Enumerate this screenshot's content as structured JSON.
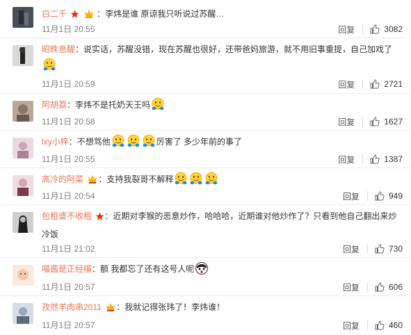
{
  "reply_label": "回复",
  "comments": [
    {
      "user": "白二千",
      "sep": "：",
      "text": "李炜是谁 原谅我只听说过苏醒…",
      "time": "11月1日 20:55",
      "likes": "3082"
    },
    {
      "user": "昭昳息醒",
      "sep": "：",
      "text": "说实话，苏醒没错，现在苏醒也很好，还带爸妈旅游，就不用旧事重提，自己加戏了",
      "time": "11月1日 20:59",
      "likes": "2721"
    },
    {
      "user": "阿胡荔",
      "sep": "：",
      "text": "李炜不是托奶天王吗",
      "time": "11月1日 20:58",
      "likes": "1627"
    },
    {
      "user": "lxy小梓",
      "sep": "：",
      "text_a": "不想骂他",
      "text_b": "厉害了 多少年前的事了",
      "time": "11月1日 20:55",
      "likes": "1387"
    },
    {
      "user": "高冷的阿菜",
      "sep": "：",
      "text": "支持我裂哥不解释",
      "time": "11月1日 20:54",
      "likes": "949"
    },
    {
      "user": "包租婆不收租",
      "sep": "：",
      "text": "近期对李猴的恶意炒作，哈哈哈，近期谁对他炒作了？只看到他自己翻出来炒冷饭",
      "time": "11月1日 21:02",
      "likes": "730"
    },
    {
      "user": "喵酱是正经喵",
      "sep": "：",
      "text": "额 我都忘了还有这号人呢",
      "time": "11月1日 20:57",
      "likes": "606"
    },
    {
      "user": "孜然羊肉串2011",
      "sep": "：",
      "text": "我就记得张玮了！李炜谁！",
      "time": "11月1日 20:57",
      "likes": "460"
    }
  ]
}
